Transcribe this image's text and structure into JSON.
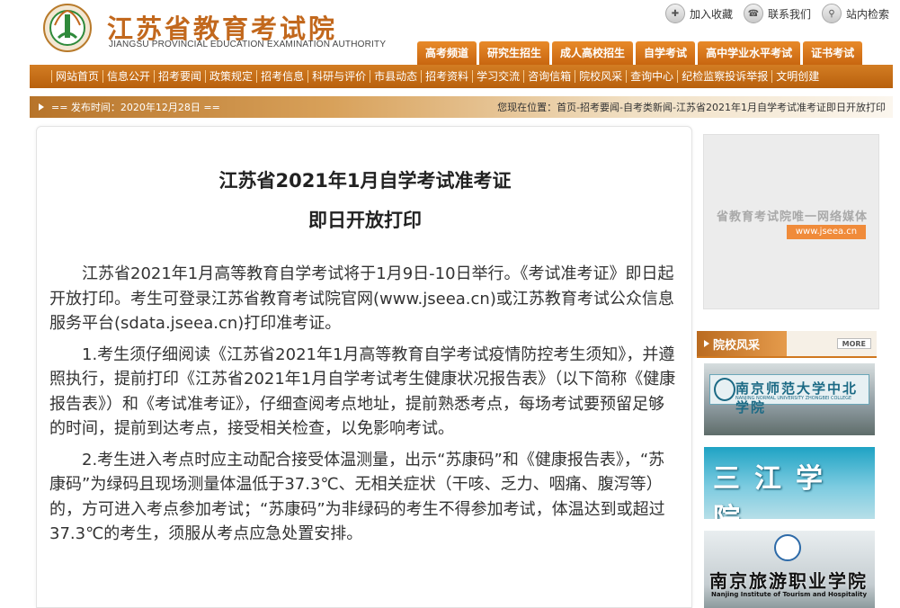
{
  "header": {
    "logo_cn": "江苏省教育考试院",
    "logo_en": "JIANGSU PROVINCIAL EDUCATION EXAMINATION AUTHORITY",
    "top_links": [
      "加入收藏",
      "联系我们",
      "站内检索"
    ],
    "main_tabs": [
      "高考频道",
      "研究生招生",
      "成人高校招生",
      "自学考试",
      "高中学业水平考试",
      "证书考试"
    ]
  },
  "subnav": [
    "网站首页",
    "信息公开",
    "招考要闻",
    "政策规定",
    "招考信息",
    "科研与评价",
    "市县动态",
    "招考资料",
    "学习交流",
    "咨询信箱",
    "院校风采",
    "查询中心",
    "纪检监察投诉举报",
    "文明创建"
  ],
  "info_bar": {
    "publish": "== 发布时间：2020年12月28日 ==",
    "breadcrumb": "您现在位置：首页-招考要闻-自考类新闻-江苏省2021年1月自学考试准考证即日开放打印"
  },
  "article": {
    "title_line1": "江苏省2021年1月自学考试准考证",
    "title_line2": "即日开放打印",
    "paragraphs": [
      "江苏省2021年1月高等教育自学考试将于1月9日-10日举行。《考试准考证》即日起开放打印。考生可登录江苏省教育考试院官网(www.jseea.cn)或江苏教育考试公众信息服务平台(sdata.jseea.cn)打印准考证。",
      "1.考生须仔细阅读《江苏省2021年1月高等教育自学考试疫情防控考生须知》，并遵照执行，提前打印《江苏省2021年1月自学考试考生健康状况报告表》（以下简称《健康报告表》）和《考试准考证》，仔细查阅考点地址，提前熟悉考点，每场考试要预留足够的时间，提前到达考点，接受相关检查，以免影响考试。",
      "2.考生进入考点时应主动配合接受体温测量，出示“苏康码”和《健康报告表》，“苏康码”为绿码且现场测量体温低于37.3℃、无相关症状（干咳、乏力、咽痛、腹泻等）的，方可进入考点参加考试；“苏康码”为非绿码的考生不得参加考试，体温达到或超过37.3℃的考生，须服从考点应急处置安排。"
    ]
  },
  "sidebar": {
    "ad_text": "省教育考试院唯一网络媒体",
    "ad_url": "www.jseea.cn",
    "section_title": "院校风采",
    "more": "MORE",
    "schools": {
      "njnu_cn": "南京师范大学中北学院",
      "njnu_en": "NANJING NORMAL UNIVERSITY ZHONGBEI COLLEGE",
      "sanjiang": "三江学院",
      "tourism_cn": "南京旅游职业学院",
      "tourism_en": "Nanjing Institute of Tourism and Hospitality"
    }
  }
}
